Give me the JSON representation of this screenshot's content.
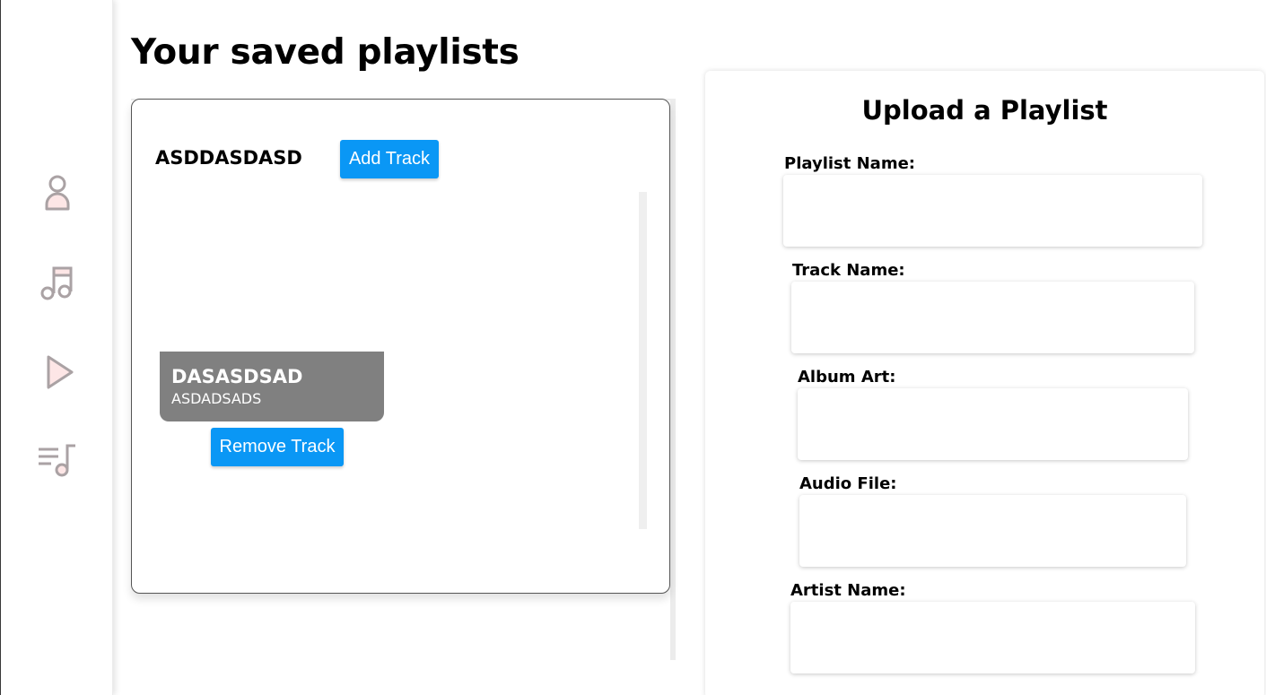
{
  "sidebar": {
    "items": [
      {
        "icon": "user-icon"
      },
      {
        "icon": "music-note-icon"
      },
      {
        "icon": "play-icon"
      },
      {
        "icon": "playlist-icon"
      }
    ]
  },
  "main": {
    "title": "Your saved playlists",
    "playlist": {
      "name": "ASDDASDASD",
      "add_track_label": "Add Track",
      "tracks": [
        {
          "title": "DASASDSAD",
          "artist": "ASDADSADS",
          "remove_label": "Remove Track"
        }
      ]
    }
  },
  "upload": {
    "title": "Upload a Playlist",
    "fields": [
      {
        "label": "Playlist Name:",
        "value": ""
      },
      {
        "label": "Track Name:",
        "value": ""
      },
      {
        "label": "Album Art:",
        "value": ""
      },
      {
        "label": "Audio File:",
        "value": ""
      },
      {
        "label": "Artist Name:",
        "value": ""
      }
    ]
  },
  "colors": {
    "button": "#0a97f5",
    "track_tile": "#808080",
    "icon_stroke": "#aaa2a4",
    "icon_fill": "#fde6e6"
  }
}
